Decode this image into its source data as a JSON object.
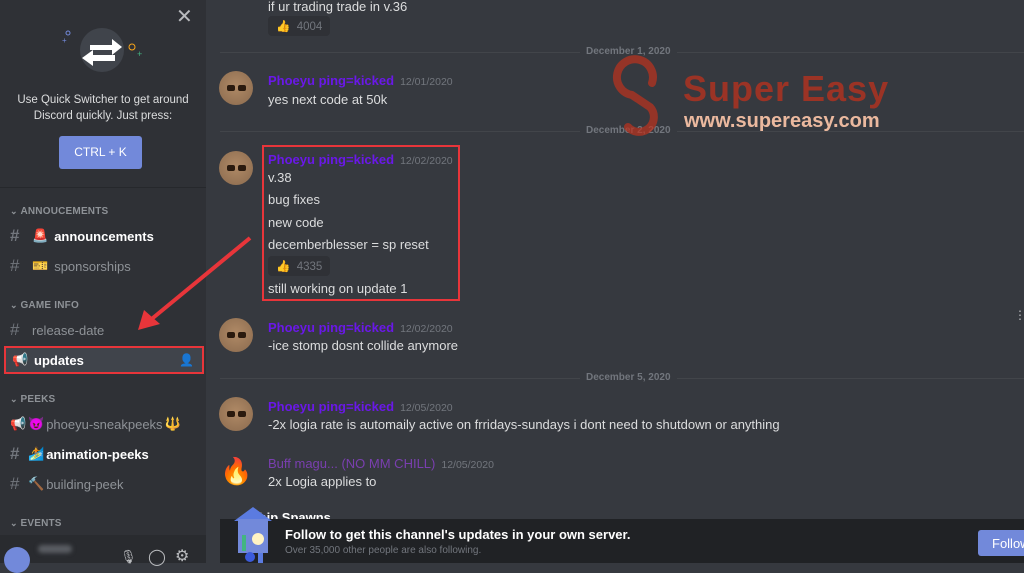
{
  "sidebar": {
    "quick_switcher": {
      "text_line1": "Use Quick Switcher to get around",
      "text_line2": "Discord quickly. Just press:",
      "shortcut": "CTRL + K"
    },
    "categories": [
      "ANNOUCEMENTS",
      "GAME INFO",
      "PEEKS",
      "EVENTS"
    ],
    "channels": [
      {
        "name": "announcements",
        "emoji": "🚨",
        "unread": true
      },
      {
        "name": "sponsorships",
        "emoji": "🎫",
        "unread": false
      },
      {
        "name": "release-date",
        "unread": false
      },
      {
        "name": "updates",
        "selected": true,
        "type": "announcement"
      },
      {
        "name": "phoeyu-sneakpeeks",
        "emoji": "😈",
        "suffix": "🔱",
        "type": "announcement"
      },
      {
        "name": "animation-peeks",
        "emoji": "🏄",
        "unread": true
      },
      {
        "name": "building-peek",
        "emoji": "🔨",
        "unread": false
      }
    ]
  },
  "messages": {
    "top_partial": "if ur trading trade in v.36",
    "top_reaction": {
      "emoji": "👍",
      "count": "4004"
    },
    "dates": [
      "December 1, 2020",
      "December 2, 2020",
      "December 5, 2020"
    ],
    "m1": {
      "author": "Phoeyu ping=kicked",
      "time": "12/01/2020",
      "text": "yes next code at 50k"
    },
    "m2": {
      "author": "Phoeyu ping=kicked",
      "time": "12/02/2020",
      "lines": [
        "v.38",
        "bug fixes",
        "new code",
        "decemberblesser = sp reset"
      ],
      "reaction": {
        "emoji": "👍",
        "count": "4335"
      },
      "after": "still working on update 1"
    },
    "m3": {
      "author": "Phoeyu ping=kicked",
      "time": "12/02/2020",
      "text": "-ice stomp dosnt collide anymore"
    },
    "m4": {
      "author": "Phoeyu ping=kicked",
      "time": "12/05/2020",
      "text": "-2x logia rate is automaily active on frridays-sundays i dont need to shutdown or anything"
    },
    "m5": {
      "author": "Buff magu... (NO MM CHILL)",
      "time": "12/05/2020",
      "text": "2x Logia applies to",
      "partial": "Ship Spawns"
    }
  },
  "follow_bar": {
    "title": "Follow to get this channel's updates in your own server.",
    "subtitle": "Over 35,000 other people are also following.",
    "button": "Follow"
  },
  "watermark": {
    "brand": "Super Easy",
    "url": "www.supereasy.com"
  },
  "colors": {
    "accent": "#7289da",
    "highlight": "#e8353a",
    "author": "#6a18e8"
  }
}
